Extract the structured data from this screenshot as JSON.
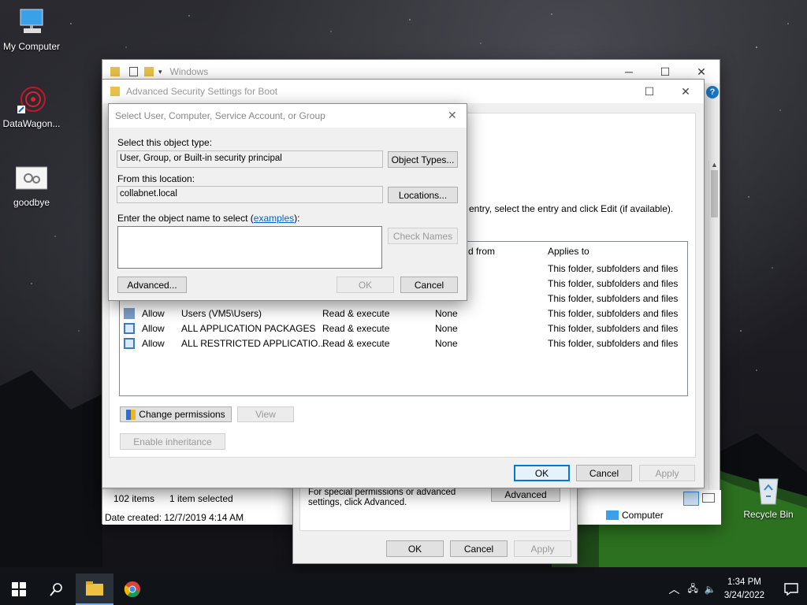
{
  "desktop": {
    "icons": [
      {
        "label": "My Computer"
      },
      {
        "label": "DataWagon..."
      },
      {
        "label": "goodbye"
      },
      {
        "label": "Recycle Bin"
      }
    ]
  },
  "explorer": {
    "title": "Windows",
    "status_items": "102 items",
    "status_selected": "1 item selected",
    "date_created": "Date created: 12/7/2019 4:14 AM",
    "location": "Computer"
  },
  "properties_dialog": {
    "special_text": "For special permissions or advanced settings, click Advanced.",
    "advanced_label": "Advanced",
    "ok_label": "OK",
    "cancel_label": "Cancel",
    "apply_label": "Apply"
  },
  "advanced_security": {
    "title": "Advanced Security Settings for Boot",
    "info_text": "entry, select the entry and click Edit (if available).",
    "col_inherited": "d from",
    "col_applies": "Applies to",
    "rows": [
      {
        "type": "",
        "principal": "",
        "access": "",
        "inherited": "",
        "applies": "This folder, subfolders and files"
      },
      {
        "type": "",
        "principal": "",
        "access": "",
        "inherited": "",
        "applies": "This folder, subfolders and files"
      },
      {
        "type": "",
        "principal": "",
        "access": "",
        "inherited": "",
        "applies": "This folder, subfolders and files"
      },
      {
        "type": "Allow",
        "principal": "Users (VM5\\Users)",
        "access": "Read & execute",
        "inherited": "None",
        "applies": "This folder, subfolders and files"
      },
      {
        "type": "Allow",
        "principal": "ALL APPLICATION PACKAGES",
        "access": "Read & execute",
        "inherited": "None",
        "applies": "This folder, subfolders and files"
      },
      {
        "type": "Allow",
        "principal": "ALL RESTRICTED APPLICATIO...",
        "access": "Read & execute",
        "inherited": "None",
        "applies": "This folder, subfolders and files"
      }
    ],
    "change_permissions_label": "Change permissions",
    "view_label": "View",
    "enable_inheritance_label": "Enable inheritance",
    "ok_label": "OK",
    "cancel_label": "Cancel",
    "apply_label": "Apply"
  },
  "select_dialog": {
    "title": "Select User, Computer, Service Account, or Group",
    "object_type_label": "Select this object type:",
    "object_type_value": "User, Group, or Built-in security principal",
    "object_types_button": "Object Types...",
    "location_label": "From this location:",
    "location_value": "collabnet.local",
    "locations_button": "Locations...",
    "enter_name_prefix": "Enter the object name to select (",
    "examples_link": "examples",
    "enter_name_suffix": "):",
    "name_value": "",
    "check_names_button": "Check Names",
    "advanced_button": "Advanced...",
    "ok_button": "OK",
    "cancel_button": "Cancel"
  },
  "taskbar": {
    "time": "1:34 PM",
    "date": "3/24/2022"
  },
  "colors": {
    "accent": "#0078d7",
    "link": "#0066cc",
    "taskbar": "#101418"
  }
}
